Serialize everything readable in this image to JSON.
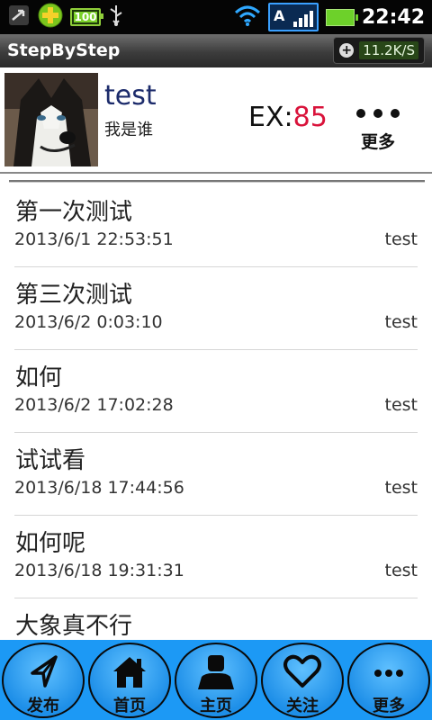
{
  "status_bar": {
    "battery_small": "100",
    "time": "22:42",
    "signal_mode": "A"
  },
  "titlebar": {
    "app_title": "StepByStep",
    "speed": "11.2K/S"
  },
  "profile": {
    "username": "test",
    "subtitle": "我是谁",
    "ex_label": "EX:",
    "ex_value": "85",
    "more_label": "更多"
  },
  "feed": [
    {
      "title": "第一次测试",
      "date": "2013/6/1 22:53:51",
      "user": "test"
    },
    {
      "title": "第三次测试",
      "date": "2013/6/2 0:03:10",
      "user": "test"
    },
    {
      "title": "如何",
      "date": "2013/6/2 17:02:28",
      "user": "test"
    },
    {
      "title": "试试看",
      "date": "2013/6/18 17:44:56",
      "user": "test"
    },
    {
      "title": "如何呢",
      "date": "2013/6/18 19:31:31",
      "user": "test"
    },
    {
      "title": "大象真不行",
      "date": "",
      "user": ""
    }
  ],
  "bottom_nav": [
    {
      "label": "发布",
      "icon": "send-arrow-icon"
    },
    {
      "label": "首页",
      "icon": "home-icon"
    },
    {
      "label": "主页",
      "icon": "person-icon"
    },
    {
      "label": "关注",
      "icon": "heart-icon"
    },
    {
      "label": "更多",
      "icon": "more-dots-icon"
    }
  ],
  "colors": {
    "accent_blue": "#1c99f5",
    "ex_value": "#d9123a",
    "username": "#1c2b6b"
  }
}
